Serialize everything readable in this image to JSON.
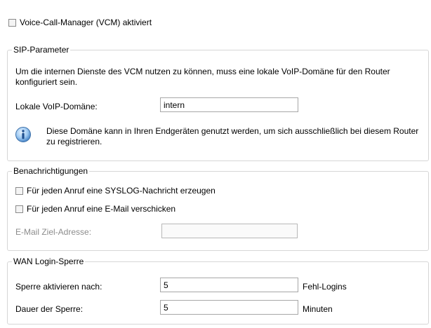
{
  "vcm": {
    "checkbox_label": "Voice-Call-Manager (VCM) aktiviert",
    "checked": false
  },
  "sip": {
    "legend": "SIP-Parameter",
    "description": "Um die internen Dienste des VCM nutzen zu können, muss eine lokale VoIP-Domäne für den Router konfiguriert sein.",
    "domain_label": "Lokale VoIP-Domäne:",
    "domain_value": "intern",
    "info_icon": "info-icon",
    "info_text": "Diese Domäne kann in Ihren Endgeräten genutzt werden, um sich ausschließlich bei diesem Router zu registrieren."
  },
  "notifications": {
    "legend": "Benachrichtigungen",
    "syslog_label": "Für jeden Anruf eine SYSLOG-Nachricht erzeugen",
    "syslog_checked": false,
    "email_label": "Für jeden Anruf eine E-Mail verschicken",
    "email_checked": false,
    "email_target_label": "E-Mail Ziel-Adresse:",
    "email_target_value": ""
  },
  "wan": {
    "legend": "WAN Login-Sperre",
    "lock_after_label": "Sperre aktivieren nach:",
    "lock_after_value": "5",
    "lock_after_unit": "Fehl-Logins",
    "duration_label": "Dauer der Sperre:",
    "duration_value": "5",
    "duration_unit": "Minuten"
  }
}
